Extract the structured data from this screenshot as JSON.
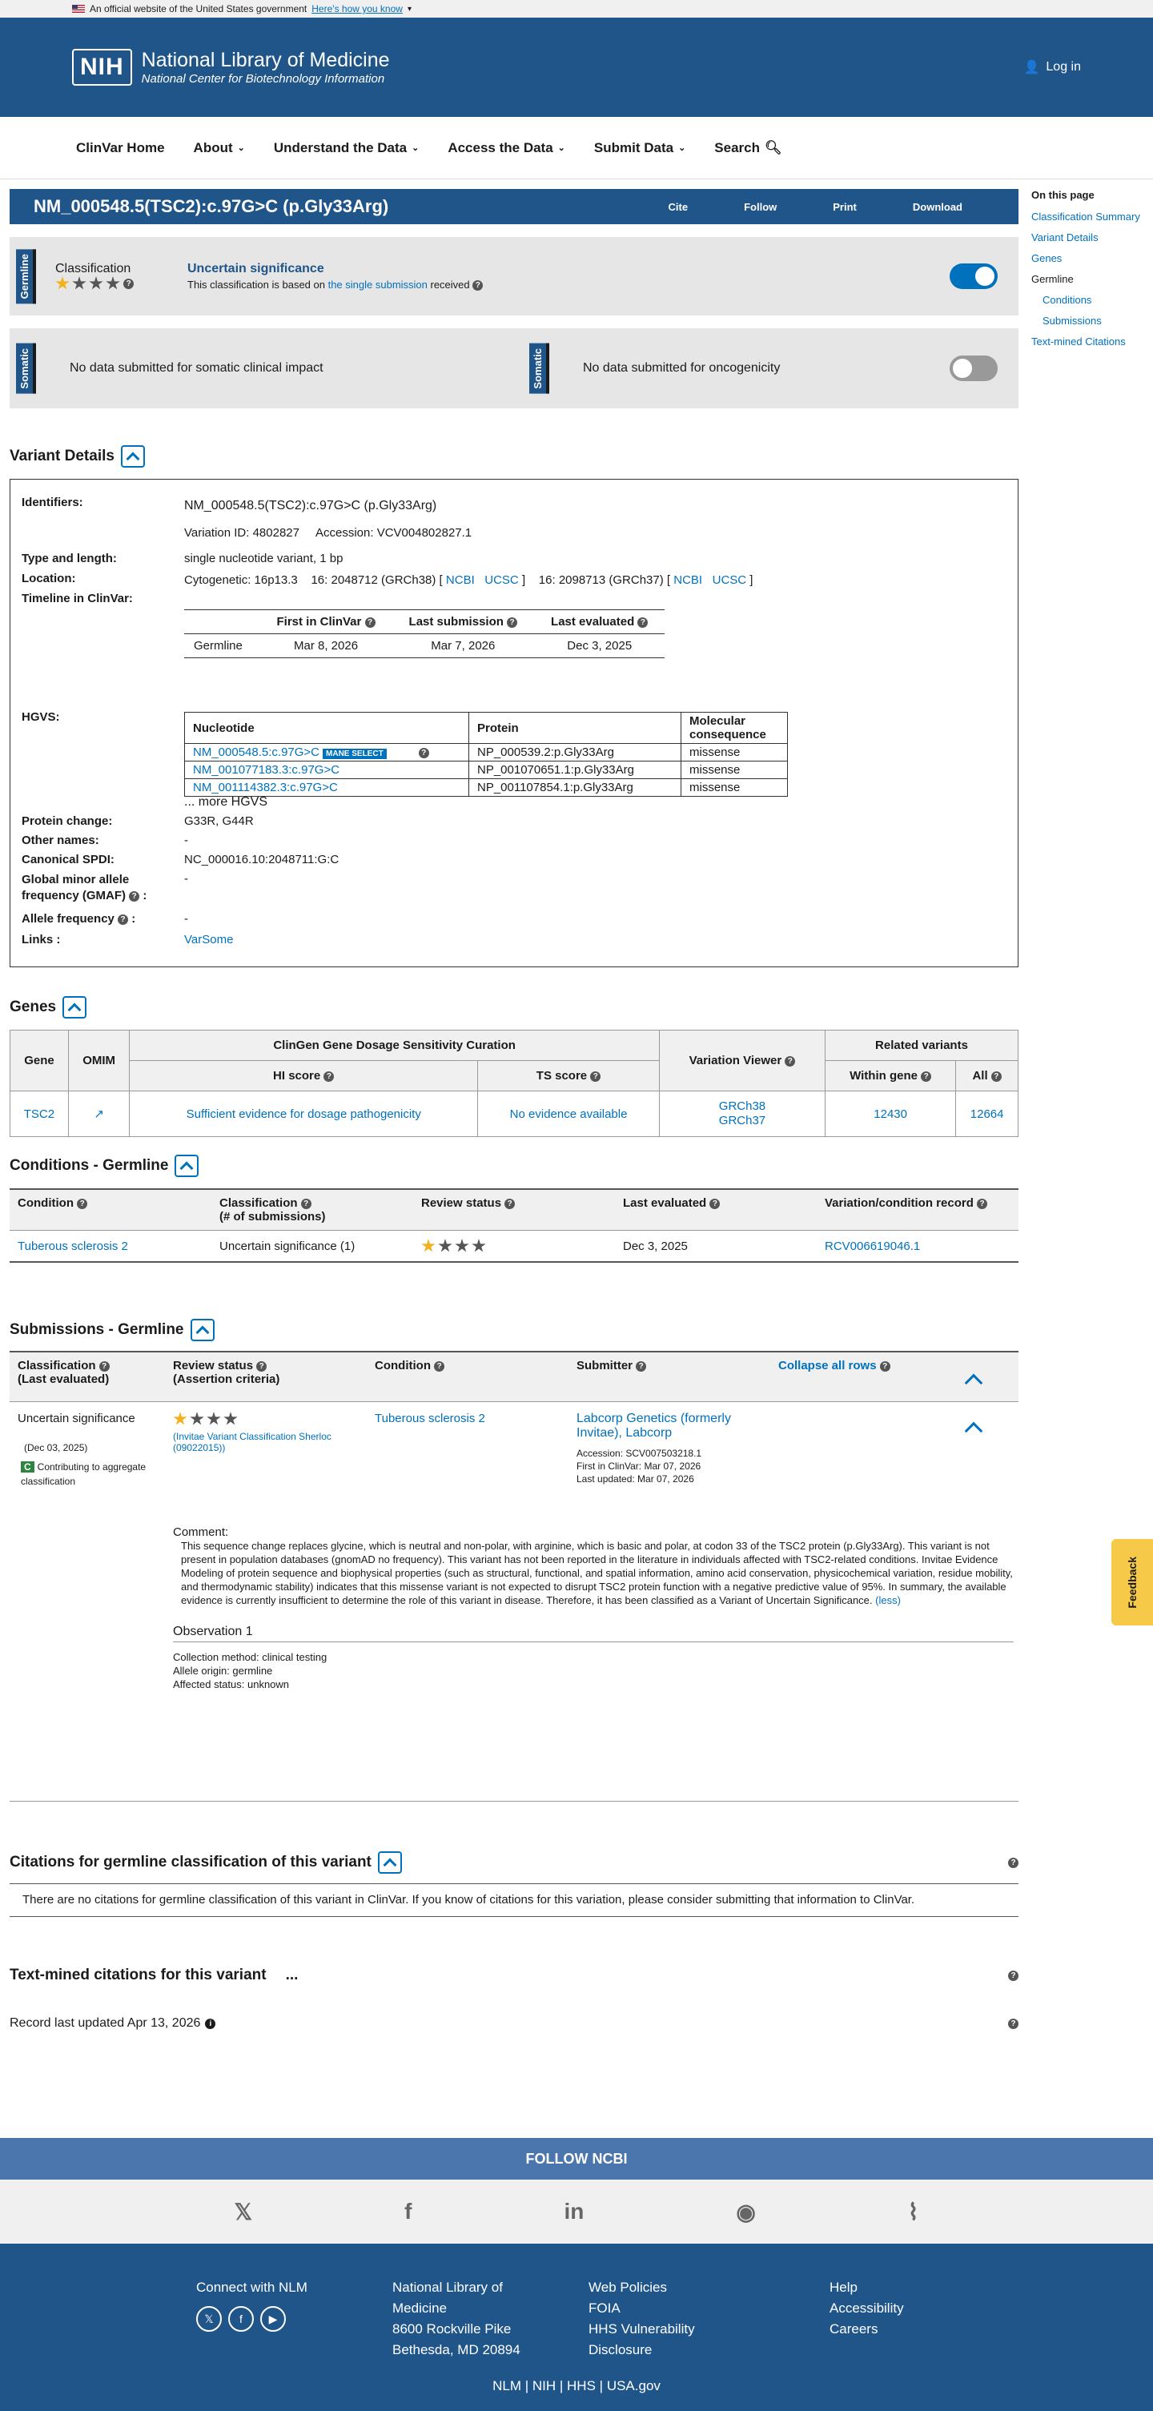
{
  "banner": {
    "text": "An official website of the United States government",
    "link": "Here's how you know"
  },
  "header": {
    "nih": "NIH",
    "title": "National Library of Medicine",
    "subtitle": "National Center for Biotechnology Information",
    "login": "Log in"
  },
  "nav": [
    "ClinVar Home",
    "About",
    "Understand the Data",
    "Access the Data",
    "Submit Data",
    "Search"
  ],
  "title": {
    "text": "NM_000548.5(TSC2):c.97G>C (p.Gly33Arg)",
    "cite": "Cite",
    "follow": "Follow",
    "print": "Print",
    "download": "Download"
  },
  "germline": {
    "tag": "Germline",
    "label": "Classification",
    "classification": "Uncertain significance",
    "basis_pre": "This classification is based on ",
    "basis_link": "the single submission",
    "basis_post": " received"
  },
  "somatic": {
    "tag": "Somatic",
    "clinical": "No data submitted for somatic clinical impact",
    "onco": "No data submitted for oncogenicity"
  },
  "side": {
    "head": "On this page",
    "items": [
      "Classification Summary",
      "Variant Details",
      "Genes",
      "Germline",
      "Conditions",
      "Submissions",
      "Text-mined Citations"
    ]
  },
  "details": {
    "head": "Variant Details",
    "identifiers_l": "Identifiers:",
    "identifier": "NM_000548.5(TSC2):c.97G>C (p.Gly33Arg)",
    "variation_id": "Variation ID: 4802827",
    "accession": "Accession: VCV004802827.1",
    "type_l": "Type and length:",
    "type": "single nucleotide variant, 1 bp",
    "location_l": "Location:",
    "cyto": "Cytogenetic: 16p13.3",
    "loc38": "16: 2048712 (GRCh38) [",
    "loc37": "16: 2098713 (GRCh37) [",
    "ncbi": "NCBI",
    "ucsc": "UCSC",
    "timeline_l": "Timeline in ClinVar:",
    "tl_h": [
      "First in ClinVar",
      "Last submission",
      "Last evaluated"
    ],
    "tl_row": [
      "Germline",
      "Mar 8, 2026",
      "Mar 7, 2026",
      "Dec 3, 2025"
    ],
    "hgvs_l": "HGVS:",
    "hg_h": [
      "Nucleotide",
      "Protein",
      "Molecular consequence"
    ],
    "hgvs": [
      [
        "NM_000548.5:c.97G>C",
        "NP_000539.2:p.Gly33Arg",
        "missense"
      ],
      [
        "NM_001077183.3:c.97G>C",
        "NP_001070651.1:p.Gly33Arg",
        "missense"
      ],
      [
        "NM_001114382.3:c.97G>C",
        "NP_001107854.1:p.Gly33Arg",
        "missense"
      ]
    ],
    "mane": "MANE SELECT",
    "more": "... more HGVS",
    "protein_l": "Protein change:",
    "protein": "G33R, G44R",
    "other_l": "Other names:",
    "other": "-",
    "spdi_l": "Canonical SPDI:",
    "spdi": "NC_000016.10:2048711:G:C",
    "gmaf_l1": "Global minor allele",
    "gmaf_l2": "frequency (GMAF)",
    "gmaf": "-",
    "af_l": "Allele frequency",
    "af": "-",
    "links_l": "Links :",
    "links": "VarSome"
  },
  "genes": {
    "head": "Genes",
    "h_gene": "Gene",
    "h_omim": "OMIM",
    "h_clingen": "ClinGen Gene Dosage Sensitivity Curation",
    "h_hi": "HI score",
    "h_ts": "TS score",
    "h_vv": "Variation Viewer",
    "h_rel": "Related variants",
    "h_within": "Within gene",
    "h_all": "All",
    "gene": "TSC2",
    "hi": "Sufficient evidence for dosage pathogenicity",
    "ts": "No evidence available",
    "grch38": "GRCh38",
    "grch37": "GRCh37",
    "within": "12430",
    "all": "12664"
  },
  "conditions": {
    "head": "Conditions - Germline",
    "h": [
      "Condition",
      "Classification",
      "(# of submissions)",
      "Review status",
      "Last evaluated",
      "Variation/condition record"
    ],
    "condition": "Tuberous sclerosis 2",
    "classification": "Uncertain significance (1)",
    "evaluated": "Dec 3, 2025",
    "record": "RCV006619046.1"
  },
  "submissions": {
    "head": "Submissions - Germline",
    "h_class": "Classification",
    "h_class2": "(Last evaluated)",
    "h_review": "Review status",
    "h_review2": "(Assertion criteria)",
    "h_cond": "Condition",
    "h_sub": "Submitter",
    "collapse": "Collapse all rows",
    "classification": "Uncertain significance",
    "date": "(Dec 03, 2025)",
    "contrib_badge": "C",
    "contrib": "Contributing to aggregate classification",
    "criteria": "(Invitae Variant Classification Sherloc (09022015))",
    "condition": "Tuberous sclerosis 2",
    "submitter": "Labcorp Genetics (formerly Invitae), Labcorp",
    "acc": "Accession: SCV007503218.1",
    "first": "First in ClinVar: Mar 07, 2026",
    "updated": "Last updated: Mar 07, 2026",
    "comment_l": "Comment:",
    "comment": "This sequence change replaces glycine, which is neutral and non-polar, with arginine, which is basic and polar, at codon 33 of the TSC2 protein (p.Gly33Arg). This variant is not present in population databases (gnomAD no frequency). This variant has not been reported in the literature in individuals affected with TSC2-related conditions. Invitae Evidence Modeling of protein sequence and biophysical properties (such as structural, functional, and spatial information, amino acid conservation, physicochemical variation, residue mobility, and thermodynamic stability) indicates that this missense variant is not expected to disrupt TSC2 protein function with a negative predictive value of 95%. In summary, the available evidence is currently insufficient to determine the role of this variant in disease. Therefore, it has been classified as a Variant of Uncertain Significance.",
    "less": "(less)",
    "obs": "Observation 1",
    "method": "Collection method: clinical testing",
    "origin": "Allele origin: germline",
    "affected": "Affected status: unknown"
  },
  "citations": {
    "head": "Citations for germline classification of this variant",
    "text": "There are no citations for germline classification of this variant in ClinVar. If you know of citations for this variation, please consider submitting that information to ClinVar."
  },
  "textmined": {
    "head": "Text-mined citations for this variant",
    "dots": "..."
  },
  "updated": "Record last updated Apr 13, 2026",
  "feedback": "Feedback",
  "footer": {
    "follow": "FOLLOW NCBI",
    "connect": "Connect with NLM",
    "addr": [
      "National Library of",
      "Medicine",
      "8600 Rockville Pike",
      "Bethesda, MD 20894"
    ],
    "col3": [
      "Web Policies",
      "FOIA",
      "HHS Vulnerability",
      "Disclosure"
    ],
    "col4": [
      "Help",
      "Accessibility",
      "Careers"
    ],
    "bottom": [
      "NLM",
      "NIH",
      "HHS",
      "USA.gov"
    ]
  }
}
